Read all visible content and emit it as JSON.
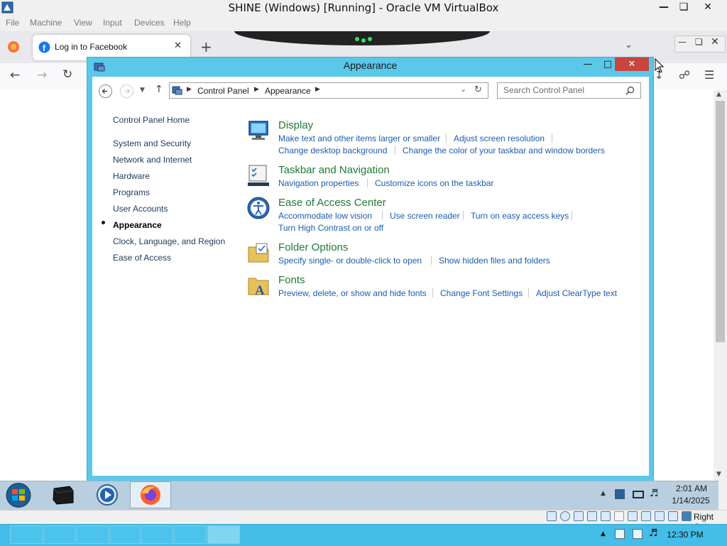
{
  "vbox": {
    "title": "SHINE (Windows) [Running] - Oracle VM VirtualBox",
    "menu": [
      "File",
      "Machine",
      "View",
      "Input",
      "Devices",
      "Help"
    ],
    "host_key_label": "Right Ctrl"
  },
  "firefox": {
    "tab_title": "Log in to Facebook"
  },
  "control_panel": {
    "window_title": "Appearance",
    "breadcrumb": [
      "Control Panel",
      "Appearance"
    ],
    "search_placeholder": "Search Control Panel",
    "sidebar": {
      "home": "Control Panel Home",
      "items": [
        "System and Security",
        "Network and Internet",
        "Hardware",
        "Programs",
        "User Accounts",
        "Appearance",
        "Clock, Language, and Region",
        "Ease of Access"
      ],
      "active": "Appearance"
    },
    "categories": [
      {
        "title": "Display",
        "icon": "display-icon",
        "links": [
          "Make text and other items larger or smaller",
          "Adjust screen resolution",
          "Change desktop background",
          "Change the color of your taskbar and window borders"
        ]
      },
      {
        "title": "Taskbar and Navigation",
        "icon": "taskbar-icon",
        "links": [
          "Navigation properties",
          "Customize icons on the taskbar"
        ]
      },
      {
        "title": "Ease of Access Center",
        "icon": "ease-of-access-icon",
        "links": [
          "Accommodate low vision",
          "Use screen reader",
          "Turn on easy access keys",
          "Turn High Contrast on or off"
        ]
      },
      {
        "title": "Folder Options",
        "icon": "folder-options-icon",
        "links": [
          "Specify single- or double-click to open",
          "Show hidden files and folders"
        ]
      },
      {
        "title": "Fonts",
        "icon": "fonts-icon",
        "links": [
          "Preview, delete, or show and hide fonts",
          "Change Font Settings",
          "Adjust ClearType text"
        ]
      }
    ]
  },
  "guest_taskbar": {
    "time": "2:01 AM",
    "date": "1/14/2025"
  },
  "host_taskbar": {
    "time": "12:30 PM"
  }
}
